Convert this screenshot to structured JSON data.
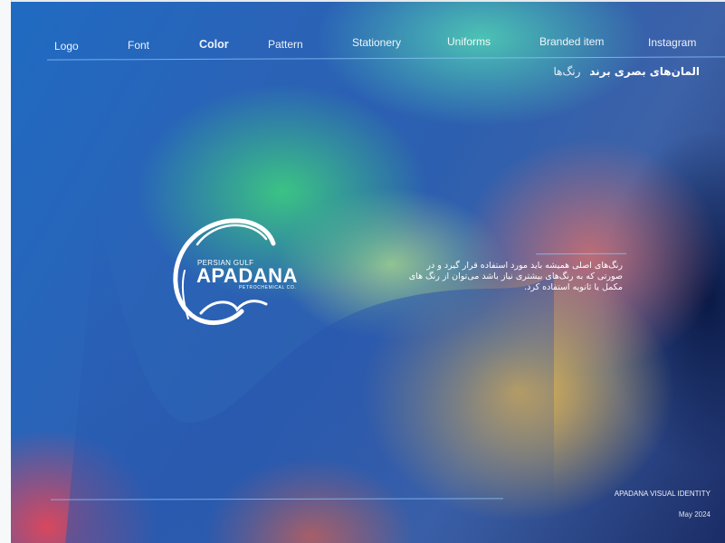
{
  "nav": {
    "items": [
      {
        "label": "Logo"
      },
      {
        "label": "Font"
      },
      {
        "label": "Color"
      },
      {
        "label": "Pattern"
      },
      {
        "label": "Stationery"
      },
      {
        "label": "Uniforms"
      },
      {
        "label": "Branded item"
      },
      {
        "label": "Instagram"
      }
    ],
    "active": "Color"
  },
  "section_title": {
    "bold": "المان‌های بصری برند",
    "light": "رنگ‌ها"
  },
  "body_text": "رنگ‌های اصلی همیشه باید مورد استفاده قرار گیرد و در صورتی که به رنگ‌های بیشتری نیاز باشد می‌توان از رنگ های مکمل یا ثانویه استفاده کرد.",
  "logo": {
    "top_line": "PERSIAN GULF",
    "wordmark": "APADANA",
    "sub_line": "PETROCHEMICAL CO."
  },
  "footer": {
    "brand": "APADANA VISUAL IDENTITY",
    "date": "May 2024"
  },
  "colors": {
    "accent_rule": "#8cc8ff",
    "text": "#ffffff"
  }
}
